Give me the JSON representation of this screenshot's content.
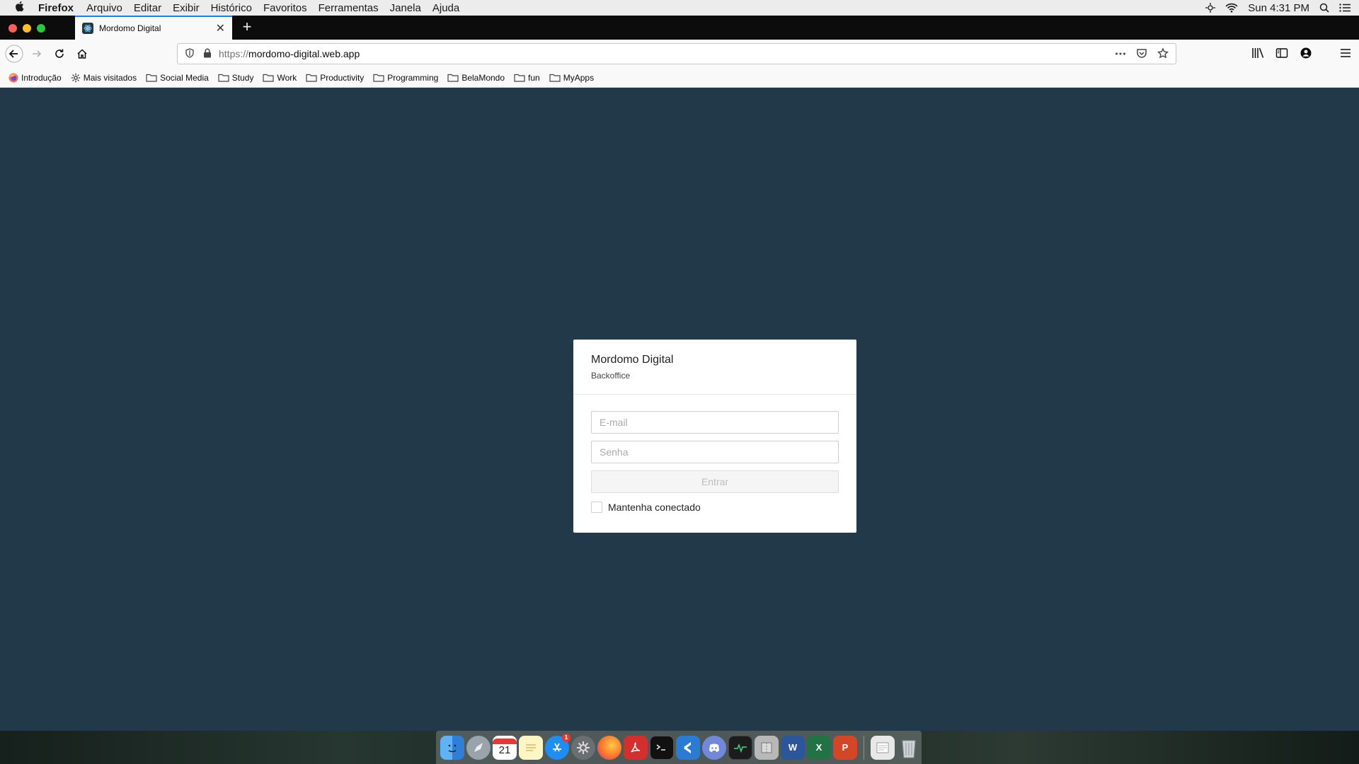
{
  "menubar": {
    "app_name": "Firefox",
    "items": [
      "Arquivo",
      "Editar",
      "Exibir",
      "Histórico",
      "Favoritos",
      "Ferramentas",
      "Janela",
      "Ajuda"
    ],
    "clock": "Sun 4:31 PM"
  },
  "tab": {
    "title": "Mordomo Digital"
  },
  "url": {
    "prefix": "https://",
    "host": "mordomo-digital.web.app"
  },
  "bookmarks": [
    "Introdução",
    "Mais visitados",
    "Social Media",
    "Study",
    "Work",
    "Productivity",
    "Programming",
    "BelaMondo",
    "fun",
    "MyApps"
  ],
  "login": {
    "title": "Mordomo Digital",
    "subtitle": "Backoffice",
    "email_placeholder": "E-mail",
    "password_placeholder": "Senha",
    "submit_label": "Entrar",
    "remember_label": "Mantenha conectado"
  },
  "dock": {
    "calendar_day": "21",
    "app_store_badge": "1",
    "word_letter": "W",
    "excel_letter": "X",
    "powerpoint_letter": "P"
  },
  "colors": {
    "page_background": "#22394a",
    "tab_accent": "#0a84ff",
    "card_background": "#ffffff"
  }
}
